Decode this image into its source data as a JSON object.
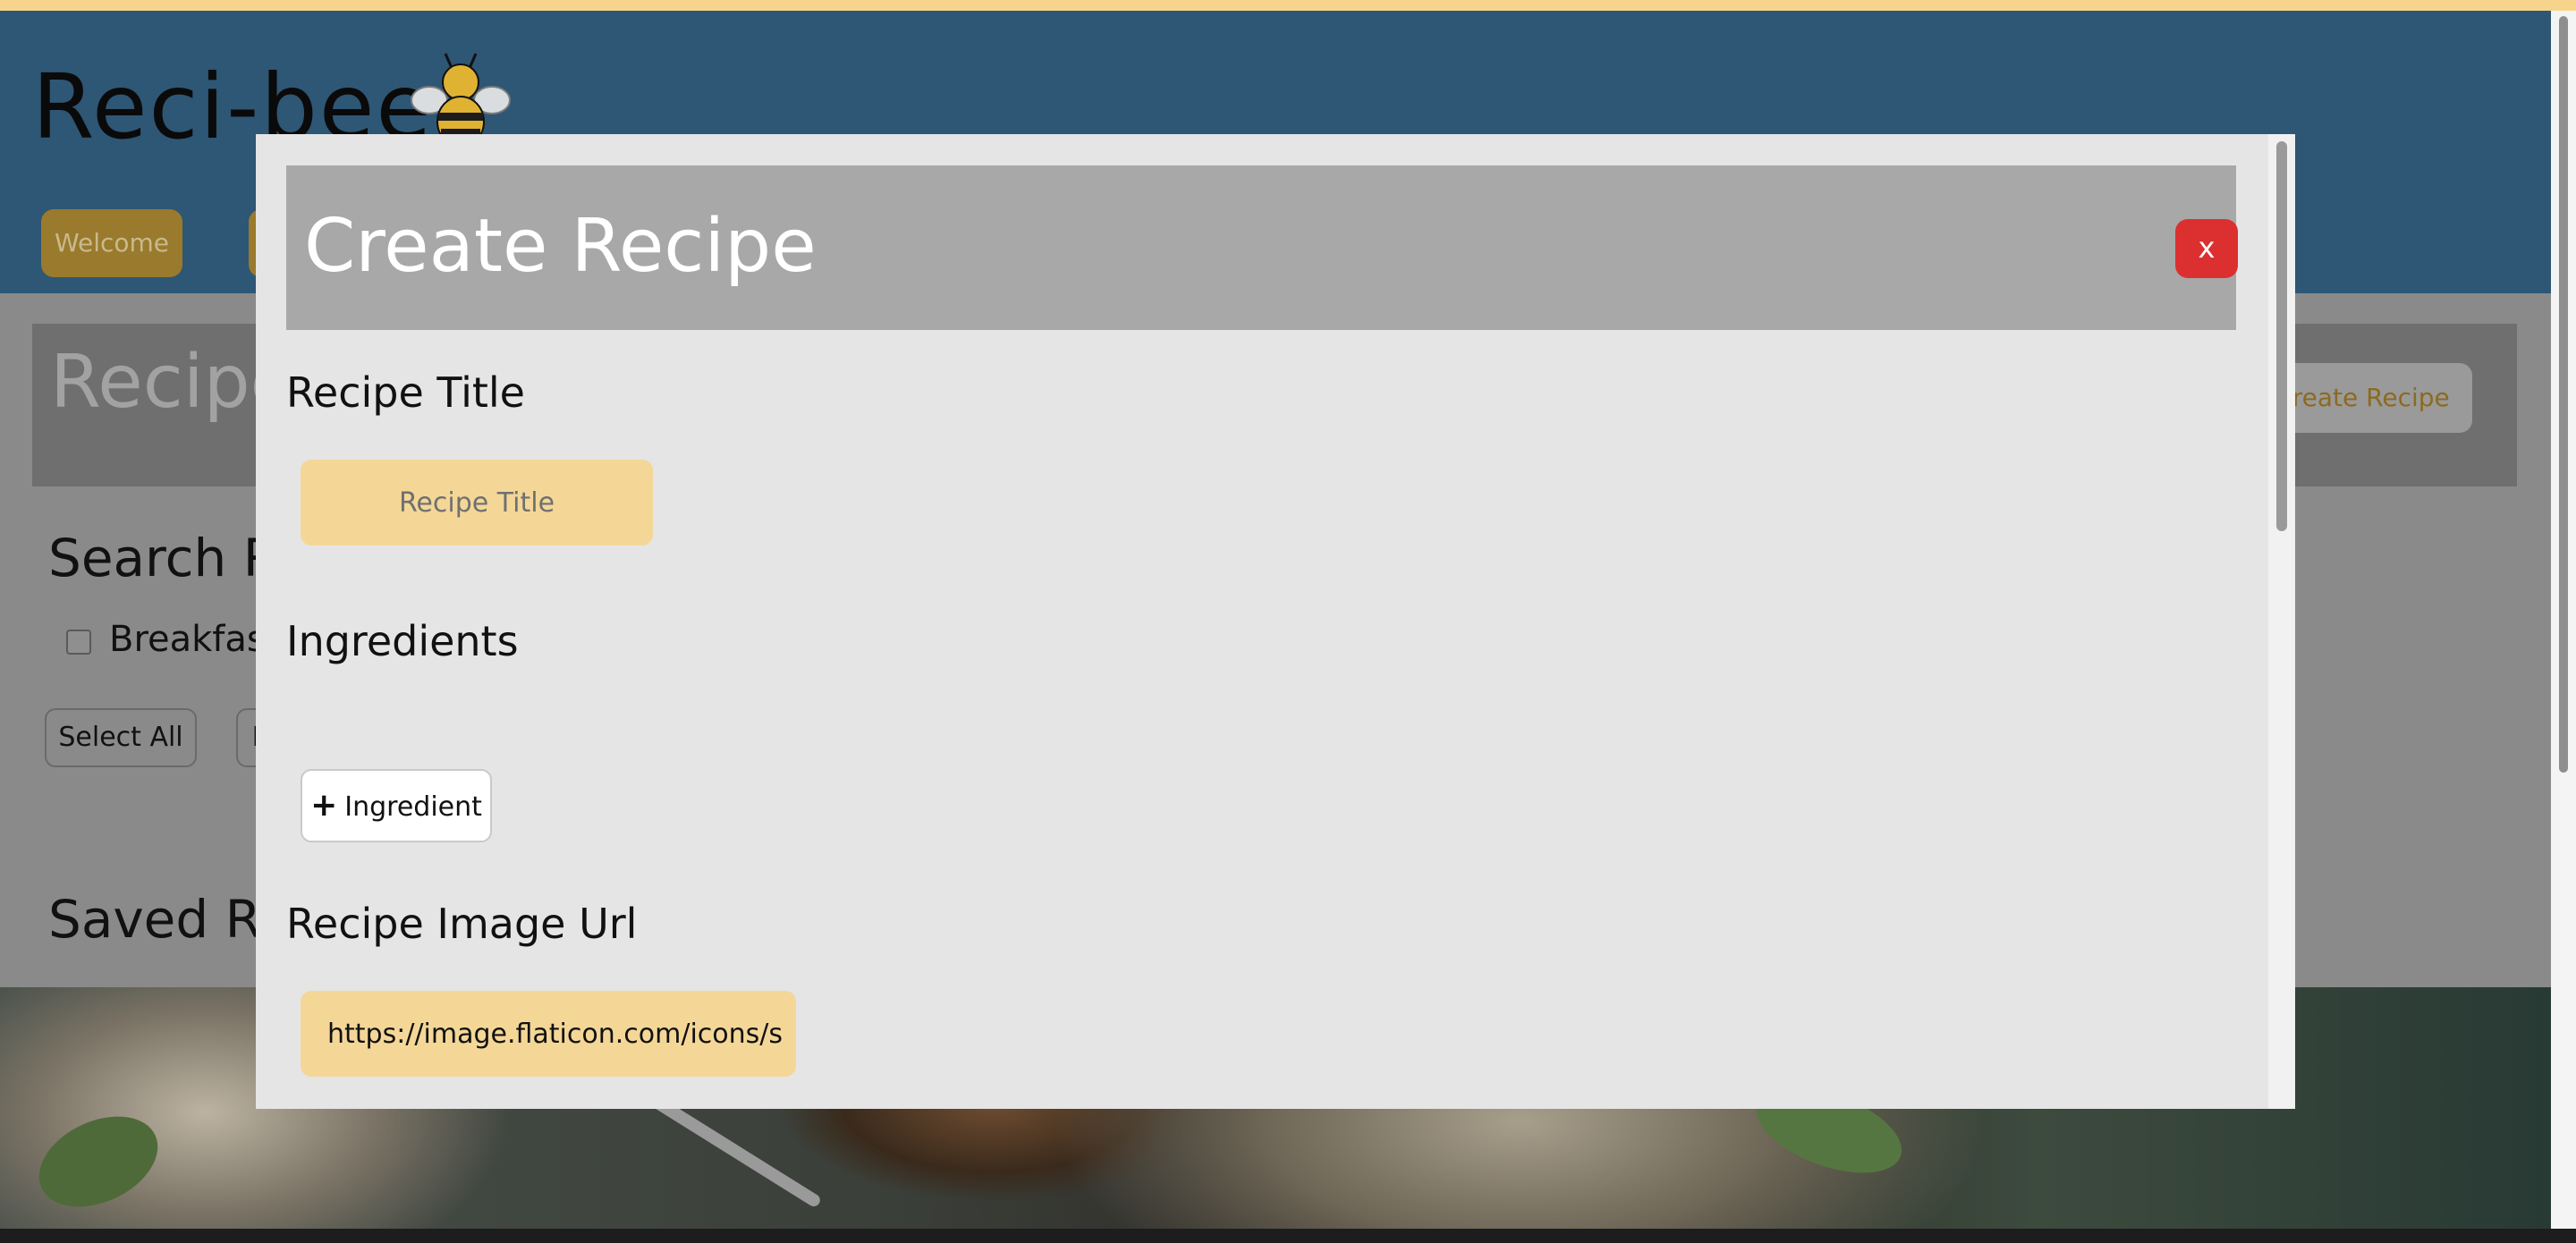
{
  "app": {
    "logo_text": "Reci-bee",
    "nav": [
      {
        "label": "Welcome"
      },
      {
        "label": ""
      }
    ]
  },
  "page": {
    "title": "Recipe",
    "create_button": "Create Recipe",
    "search_heading": "Search R",
    "filters": [
      {
        "label": "Breakfas",
        "checked": false
      }
    ],
    "buttons": [
      {
        "label": "Select All"
      },
      {
        "label": "I"
      }
    ],
    "saved_heading": "Saved Re"
  },
  "modal": {
    "title": "Create Recipe",
    "close_label": "x",
    "recipe_title_label": "Recipe Title",
    "recipe_title_placeholder": "Recipe Title",
    "ingredients_label": "Ingredients",
    "add_ingredient_label": "Ingredient",
    "image_url_label": "Recipe Image Url",
    "image_url_value": "https://image.flaticon.com/icons/s"
  },
  "colors": {
    "accent": "#f4d797",
    "header_bg": "#2e5675",
    "close_button": "#dc2f2f",
    "modal_bg": "#e5e5e5",
    "modal_header": "#a8a8a8"
  },
  "icons": {
    "bee": "bee-icon",
    "plus": "plus-icon"
  }
}
